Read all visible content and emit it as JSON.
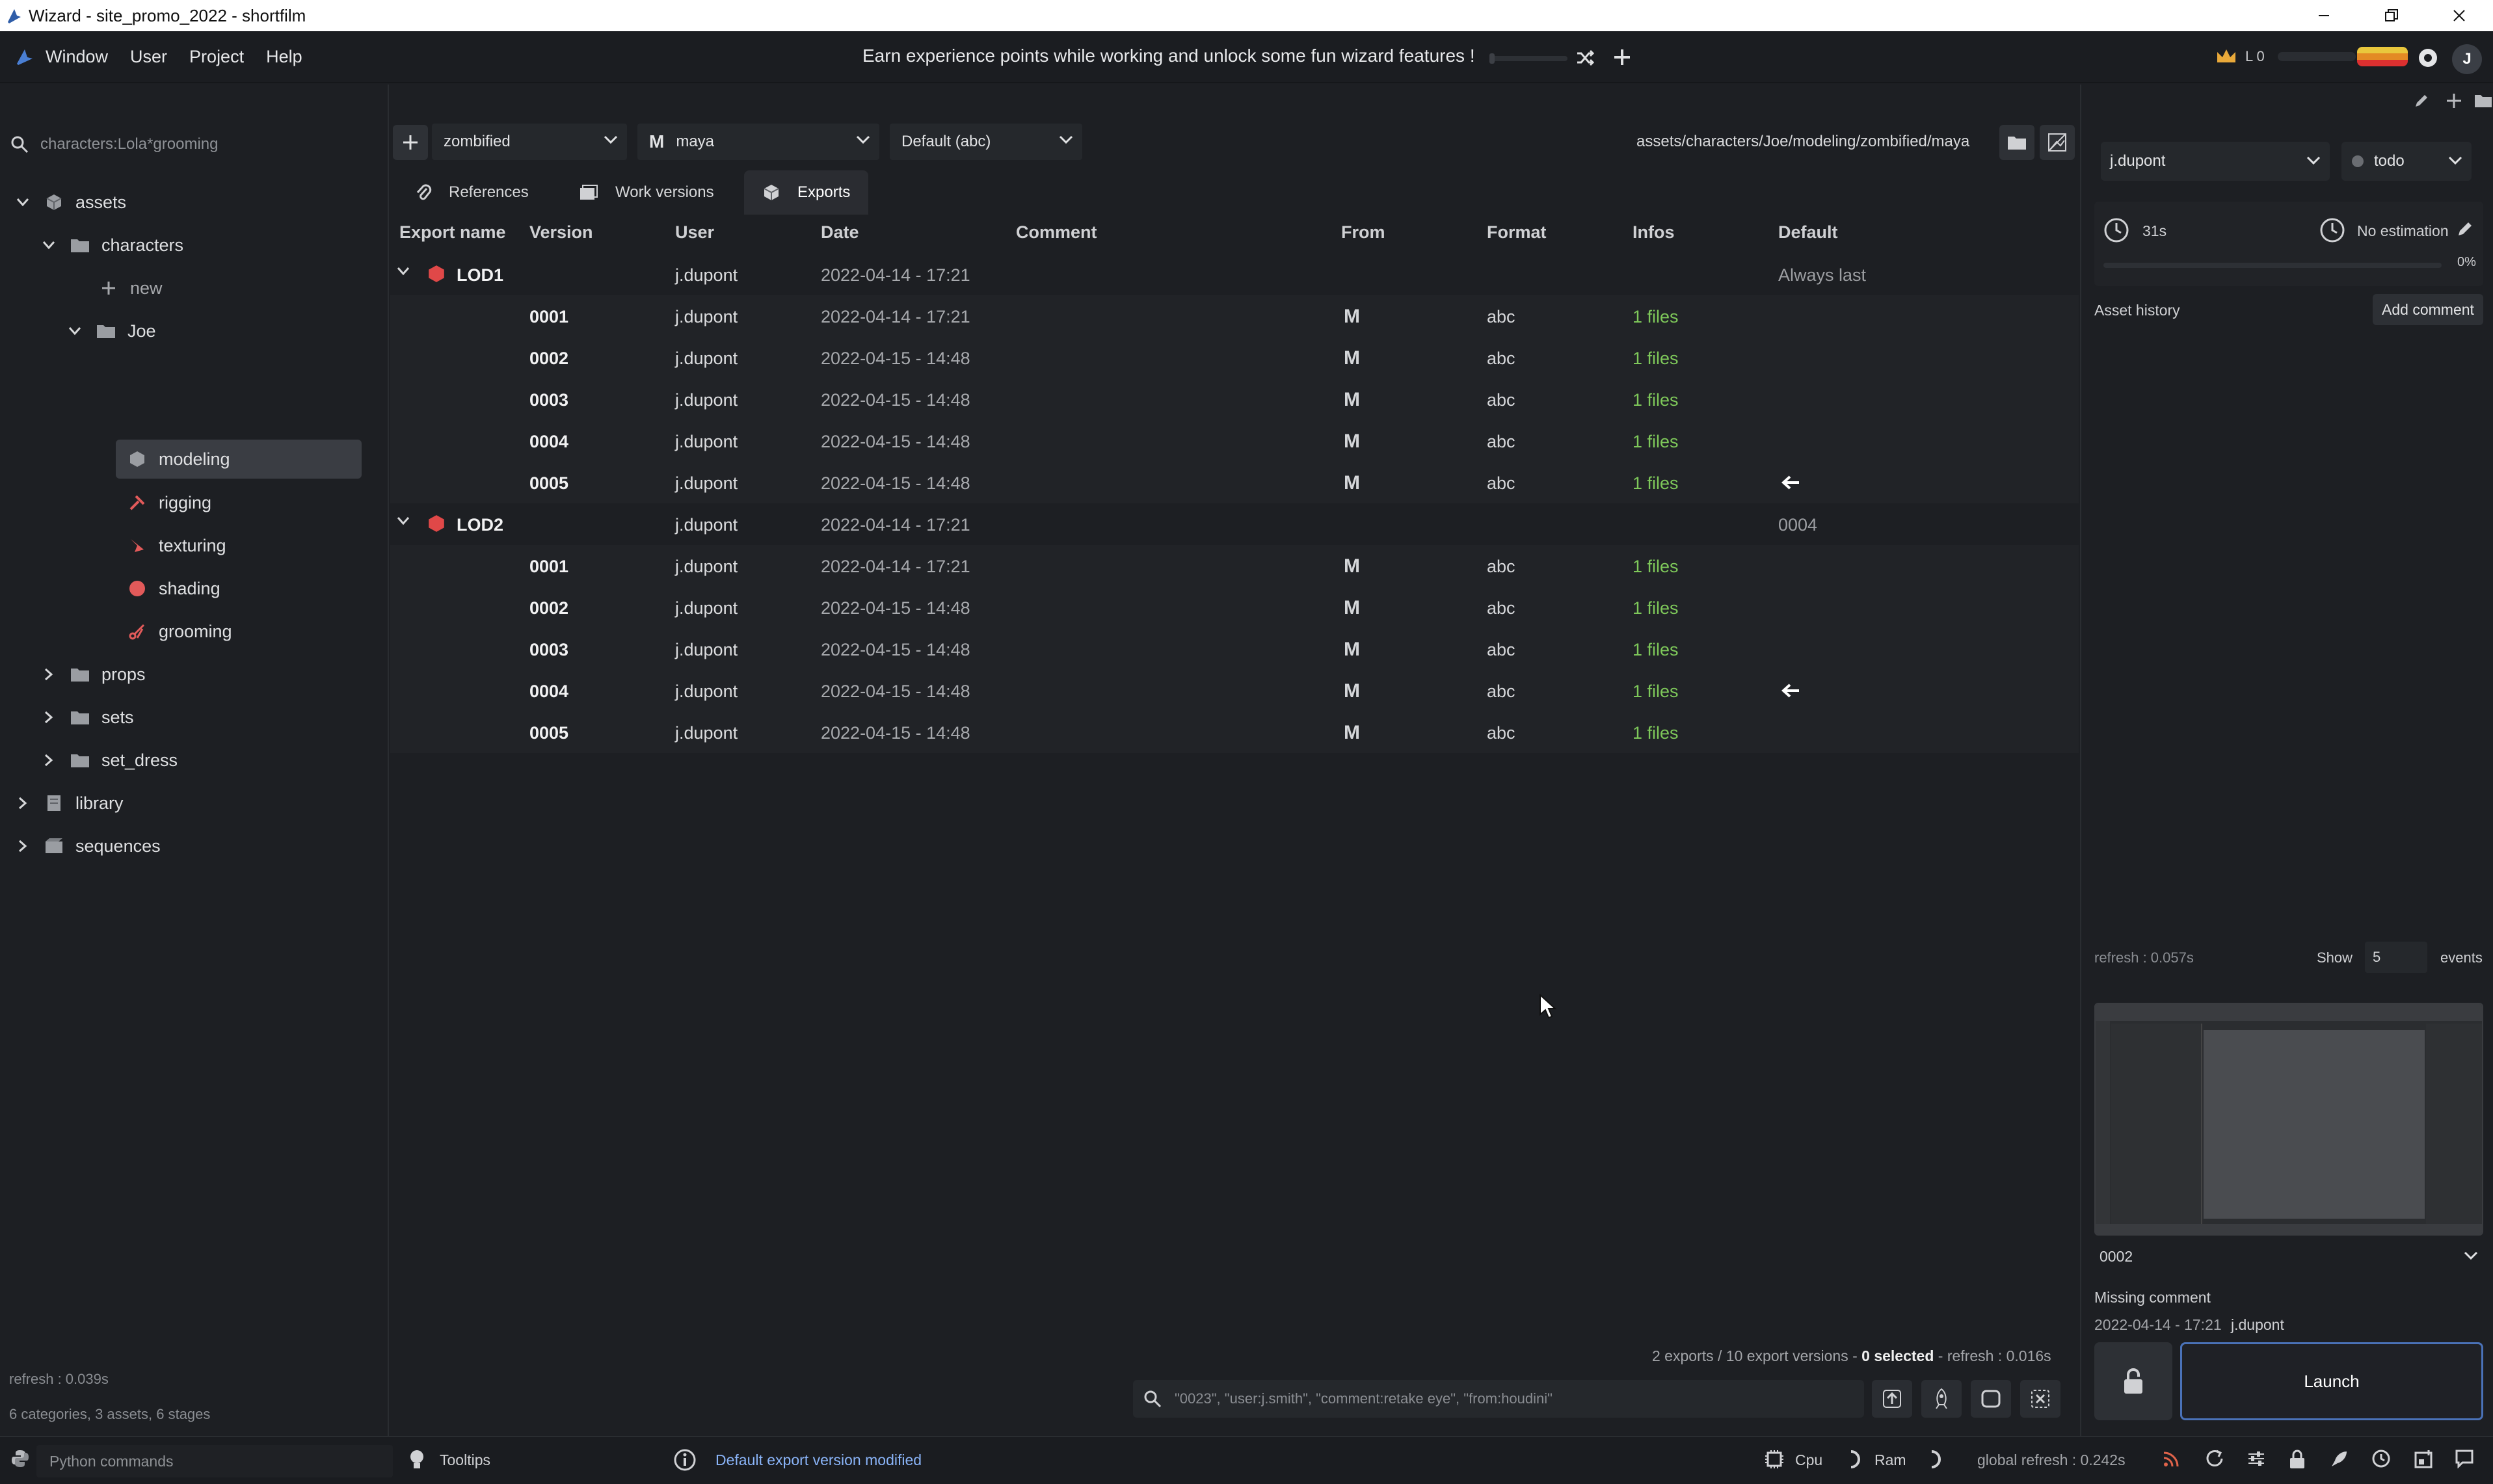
{
  "window": {
    "title": "Wizard - site_promo_2022 - shortfilm"
  },
  "menu": {
    "items": [
      "Window",
      "User",
      "Project",
      "Help"
    ],
    "xp_message": "Earn experience points while working and unlock some fun wizard features !",
    "level": "L 0",
    "avatar_initial": "J"
  },
  "left_panel": {
    "search_value": "characters:Lola*grooming",
    "tree": [
      {
        "label": "assets",
        "icon": "asset-cube-icon",
        "expanded": true
      },
      {
        "label": "characters",
        "icon": "folder-icon",
        "expanded": true
      },
      {
        "label": "new",
        "icon": "plus-icon"
      },
      {
        "label": "Joe",
        "icon": "folder-icon",
        "expanded": true
      },
      {
        "label": "modeling",
        "icon": "modeling-cube-icon",
        "selected": true
      },
      {
        "label": "rigging",
        "icon": "rigging-icon"
      },
      {
        "label": "texturing",
        "icon": "texturing-brush-icon"
      },
      {
        "label": "shading",
        "icon": "shading-ball-icon"
      },
      {
        "label": "grooming",
        "icon": "grooming-scissors-icon"
      },
      {
        "label": "props",
        "icon": "folder-icon"
      },
      {
        "label": "sets",
        "icon": "folder-icon"
      },
      {
        "label": "set_dress",
        "icon": "folder-icon"
      },
      {
        "label": "library",
        "icon": "library-icon"
      },
      {
        "label": "sequences",
        "icon": "sequences-icon"
      }
    ],
    "footer_refresh": "refresh : 0.039s",
    "footer_summary": "6 categories, 3 assets, 6 stages"
  },
  "toolbar": {
    "variant": "zombified",
    "software": "maya",
    "export_type": "Default (abc)",
    "path": "assets/characters/Joe/modeling/zombified/maya"
  },
  "tabs": [
    {
      "label": "References",
      "active": false
    },
    {
      "label": "Work versions",
      "active": false
    },
    {
      "label": "Exports",
      "active": true
    }
  ],
  "table": {
    "columns": [
      "Export name",
      "Version",
      "User",
      "Date",
      "Comment",
      "From",
      "Format",
      "Infos",
      "Default"
    ],
    "groups": [
      {
        "name": "LOD1",
        "user": "j.dupont",
        "date": "2022-04-14 - 17:21",
        "default": "Always last",
        "rows": [
          {
            "version": "0001",
            "user": "j.dupont",
            "date": "2022-04-14 - 17:21",
            "from": "M",
            "format": "abc",
            "infos": "1 files",
            "default_arrow": false
          },
          {
            "version": "0002",
            "user": "j.dupont",
            "date": "2022-04-15 - 14:48",
            "from": "M",
            "format": "abc",
            "infos": "1 files",
            "default_arrow": false
          },
          {
            "version": "0003",
            "user": "j.dupont",
            "date": "2022-04-15 - 14:48",
            "from": "M",
            "format": "abc",
            "infos": "1 files",
            "default_arrow": false
          },
          {
            "version": "0004",
            "user": "j.dupont",
            "date": "2022-04-15 - 14:48",
            "from": "M",
            "format": "abc",
            "infos": "1 files",
            "default_arrow": false
          },
          {
            "version": "0005",
            "user": "j.dupont",
            "date": "2022-04-15 - 14:48",
            "from": "M",
            "format": "abc",
            "infos": "1 files",
            "default_arrow": true
          }
        ]
      },
      {
        "name": "LOD2",
        "user": "j.dupont",
        "date": "2022-04-14 - 17:21",
        "default": "0004",
        "rows": [
          {
            "version": "0001",
            "user": "j.dupont",
            "date": "2022-04-14 - 17:21",
            "from": "M",
            "format": "abc",
            "infos": "1 files",
            "default_arrow": false
          },
          {
            "version": "0002",
            "user": "j.dupont",
            "date": "2022-04-15 - 14:48",
            "from": "M",
            "format": "abc",
            "infos": "1 files",
            "default_arrow": false
          },
          {
            "version": "0003",
            "user": "j.dupont",
            "date": "2022-04-15 - 14:48",
            "from": "M",
            "format": "abc",
            "infos": "1 files",
            "default_arrow": false
          },
          {
            "version": "0004",
            "user": "j.dupont",
            "date": "2022-04-15 - 14:48",
            "from": "M",
            "format": "abc",
            "infos": "1 files",
            "default_arrow": true
          },
          {
            "version": "0005",
            "user": "j.dupont",
            "date": "2022-04-15 - 14:48",
            "from": "M",
            "format": "abc",
            "infos": "1 files",
            "default_arrow": false
          }
        ]
      }
    ]
  },
  "status": {
    "counts": "2 exports / 10 export versions - ",
    "selected": "0 selected",
    "refresh": " - refresh : 0.016s"
  },
  "filter": {
    "placeholder": "\"0023\", \"user:j.smith\", \"comment:retake eye\", \"from:houdini\""
  },
  "right_panel": {
    "user": "j.dupont",
    "state": "todo",
    "time_spent": "31s",
    "estimation": "No estimation",
    "progress": "0%",
    "progress_value": 0,
    "history_label": "Asset history",
    "add_comment": "Add comment",
    "refresh": "refresh : 0.057s",
    "show_label": "Show",
    "show_count": "5",
    "events_label": "events",
    "version": "0002",
    "comment": "Missing comment",
    "date": "2022-04-14 - 17:21",
    "author": "j.dupont",
    "launch": "Launch"
  },
  "bottom_bar": {
    "python_placeholder": "Python commands",
    "tooltips": "Tooltips",
    "notification": "Default export version modified",
    "cpu": "Cpu",
    "ram": "Ram",
    "global_refresh": "global refresh : 0.242s"
  },
  "colors": {
    "accent_green": "#7ec85a",
    "lod_red": "#e04848",
    "launch_border": "#4a72b8",
    "notification_blue": "#8ab4f8"
  }
}
